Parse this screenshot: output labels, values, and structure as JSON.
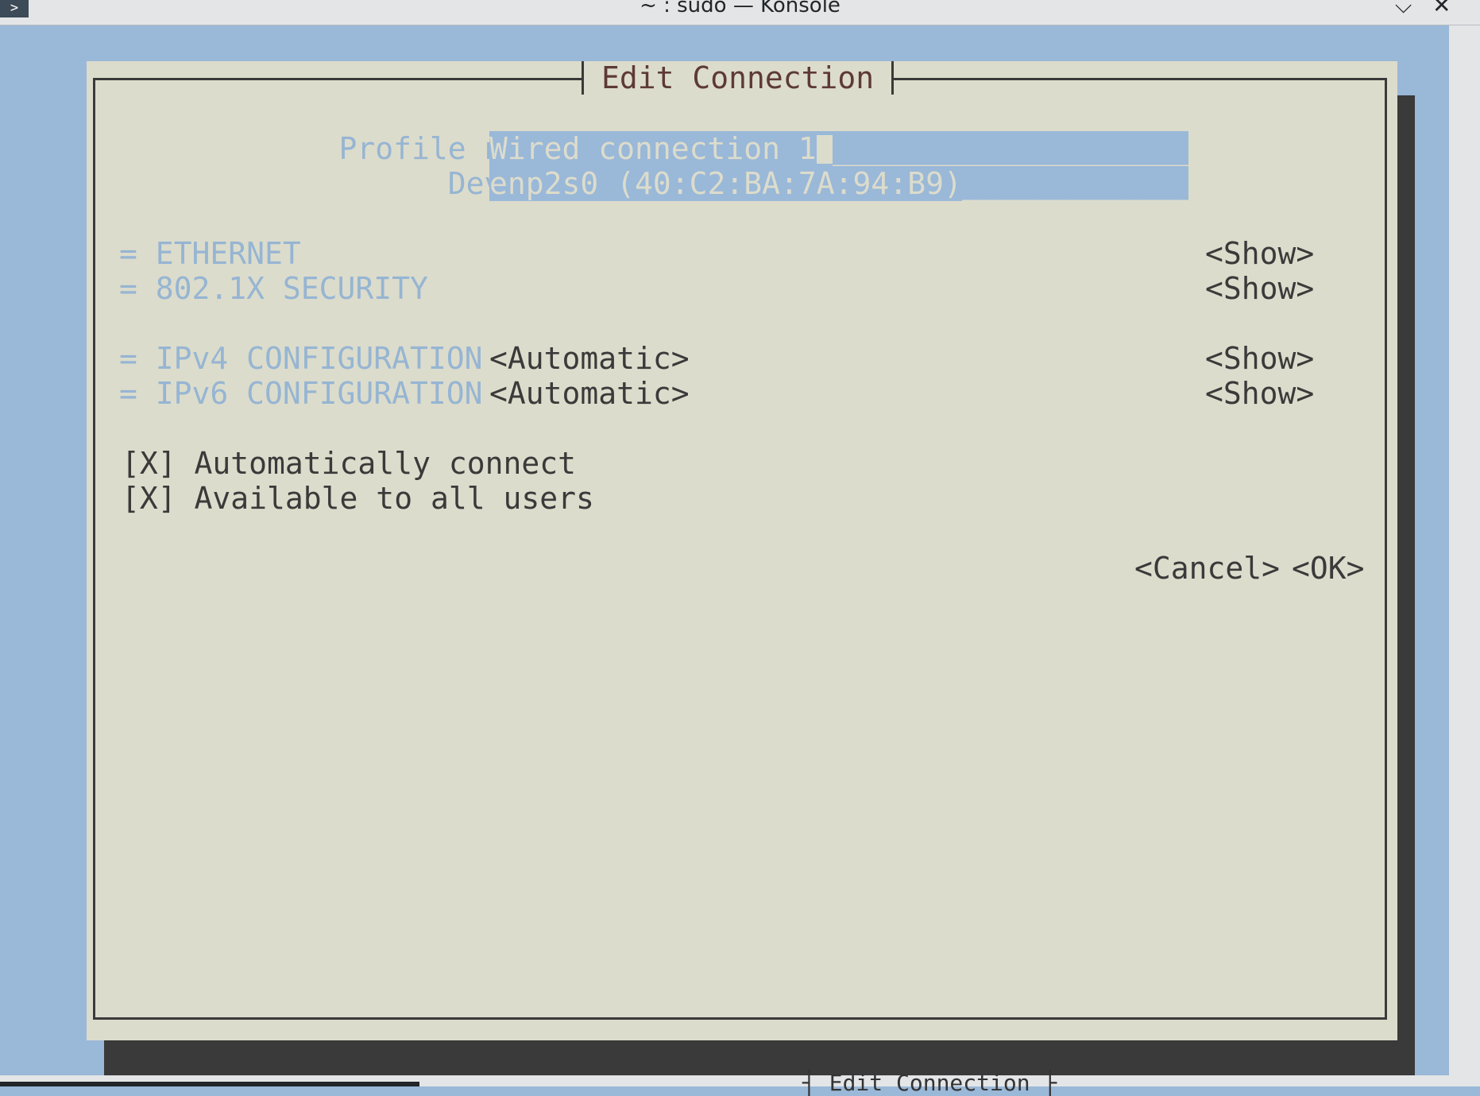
{
  "window": {
    "title": "~ : sudo — Konsole",
    "app_icon": ">"
  },
  "dialog": {
    "title": "Edit Connection",
    "profile_name_label": "Profile name",
    "profile_name_value": "Wired connection 1",
    "profile_name_fill": "____________________",
    "device_label": "Device",
    "device_value": "enp2s0 (40:C2:BA:7A:94:B9)",
    "device_fill": "_____________",
    "sections": [
      {
        "label": "= ETHERNET",
        "value": "",
        "button": "<Show>"
      },
      {
        "label": "= 802.1X SECURITY",
        "value": "",
        "button": "<Show>"
      },
      {
        "label": "= IPv4 CONFIGURATION",
        "value": "<Automatic>",
        "button": "<Show>"
      },
      {
        "label": "= IPv6 CONFIGURATION",
        "value": "<Automatic>",
        "button": "<Show>"
      }
    ],
    "checkboxes": [
      {
        "mark": "[X]",
        "label": "Automatically connect"
      },
      {
        "mark": "[X]",
        "label": "Available to all users"
      }
    ],
    "cancel_label": "<Cancel>",
    "ok_label": "<OK>"
  },
  "status": {
    "text": "┤ Edit Connection ├"
  },
  "colors": {
    "dialog_bg": "#dcdccc",
    "terminal_bg": "#9ab8d8",
    "label": "#96b5d3",
    "title": "#5e3a35",
    "text": "#3a3a3a"
  }
}
